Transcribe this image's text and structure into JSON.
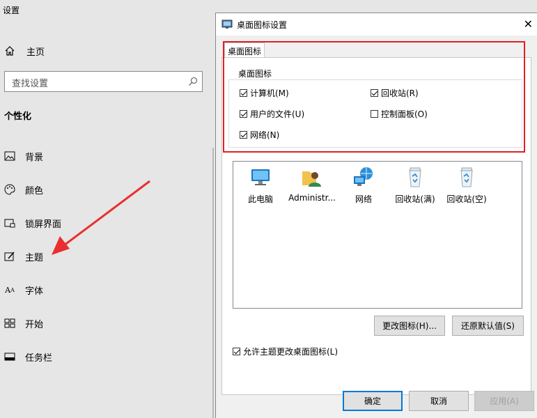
{
  "settings": {
    "title": "设置",
    "home": "主页",
    "search_placeholder": "查找设置",
    "section": "个性化",
    "nav": [
      "背景",
      "颜色",
      "锁屏界面",
      "主题",
      "字体",
      "开始",
      "任务栏"
    ]
  },
  "dialog": {
    "title": "桌面图标设置",
    "tab": "桌面图标",
    "group_label": "桌面图标",
    "checkboxes": [
      {
        "label": "计算机(M)",
        "checked": true
      },
      {
        "label": "回收站(R)",
        "checked": true
      },
      {
        "label": "用户的文件(U)",
        "checked": true
      },
      {
        "label": "控制面板(O)",
        "checked": false
      },
      {
        "label": "网络(N)",
        "checked": true
      }
    ],
    "icons": [
      {
        "label": "此电脑",
        "icon": "computer-icon"
      },
      {
        "label": "Administr...",
        "icon": "user-folder-icon"
      },
      {
        "label": "网络",
        "icon": "network-icon"
      },
      {
        "label": "回收站(满)",
        "icon": "recycle-bin-full-icon"
      },
      {
        "label": "回收站(空)",
        "icon": "recycle-bin-empty-icon"
      }
    ],
    "change_icon": "更改图标(H)...",
    "restore_default": "还原默认值(S)",
    "allow_themes": "允许主题更改桌面图标(L)",
    "allow_themes_checked": true,
    "ok": "确定",
    "cancel": "取消",
    "apply": "应用(A)"
  },
  "colors": {
    "highlight": "#e02020",
    "accent": "#0078d7",
    "arrow": "#e83030"
  }
}
